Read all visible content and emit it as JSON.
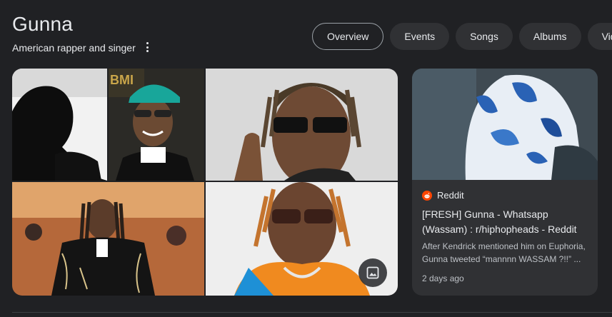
{
  "entity": {
    "title": "Gunna",
    "subtitle": "American rapper and singer"
  },
  "tabs": [
    {
      "label": "Overview",
      "active": true
    },
    {
      "label": "Events",
      "active": false
    },
    {
      "label": "Songs",
      "active": false
    },
    {
      "label": "Albums",
      "active": false
    },
    {
      "label": "Vid",
      "active": false
    }
  ],
  "images": {
    "view_images_icon": "image-icon"
  },
  "card": {
    "source": "Reddit",
    "source_icon": "reddit-icon",
    "title": "[FRESH] Gunna - Whatsapp (Wassam) : r/hiphopheads - Reddit",
    "snippet": "After Kendrick mentioned him on Euphoria, Gunna tweeted “mannnn WASSAM ?!!” ...",
    "date": "2 days ago"
  },
  "colors": {
    "background": "#202124",
    "chip": "#303134",
    "reddit": "#ff4500"
  }
}
